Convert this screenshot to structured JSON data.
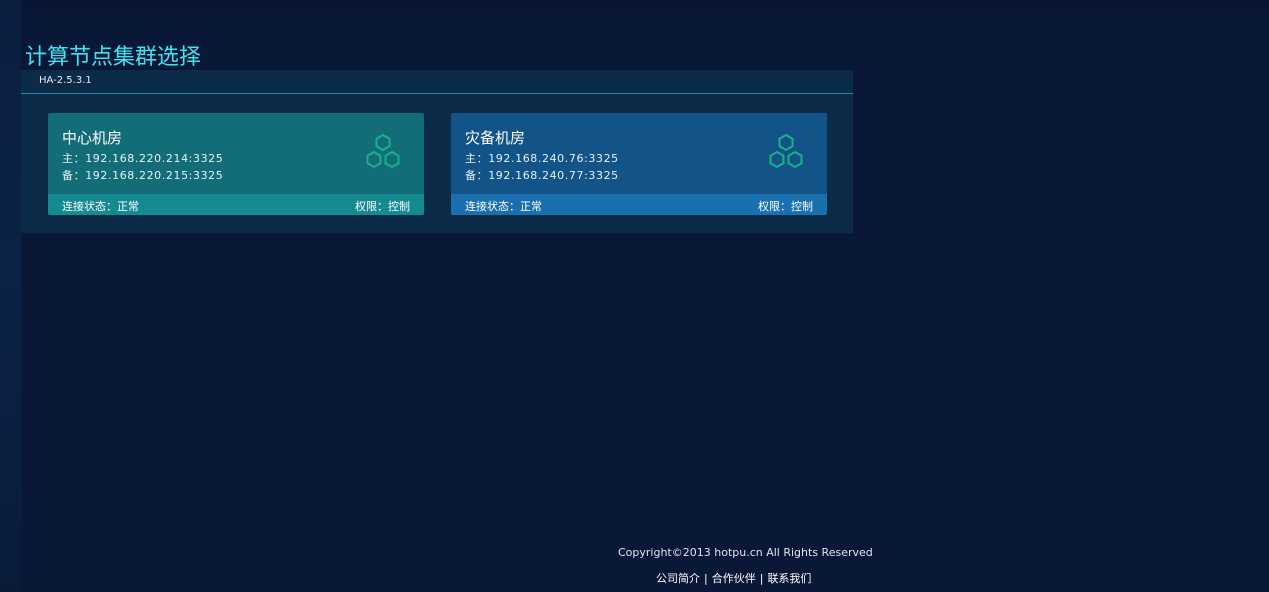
{
  "page": {
    "title": "计算节点集群选择"
  },
  "panel": {
    "version": "HA-2.5.3.1"
  },
  "clusters": [
    {
      "name": "中心机房",
      "primary": "主：192.168.220.214:3325",
      "backup": "备：192.168.220.215:3325",
      "status": "连接状态：正常",
      "permission": "权限：控制",
      "icon": "hexagon-cluster-icon",
      "color": "#136d78",
      "footer_color": "#168a91"
    },
    {
      "name": "灾备机房",
      "primary": "主：192.168.240.76:3325",
      "backup": "备：192.168.240.77:3325",
      "status": "连接状态：正常",
      "permission": "权限：控制",
      "icon": "hexagon-cluster-icon",
      "color": "#125487",
      "footer_color": "#1a70ae"
    }
  ],
  "footer": {
    "copyright": "Copyright©2013 hotpu.cn All Rights Reserved",
    "links": [
      "公司简介",
      "合作伙伴",
      "联系我们"
    ],
    "separator": "|"
  },
  "colors": {
    "background": "#0a1838",
    "title": "#3fe2f0",
    "icon_stroke": "#19b08a"
  }
}
